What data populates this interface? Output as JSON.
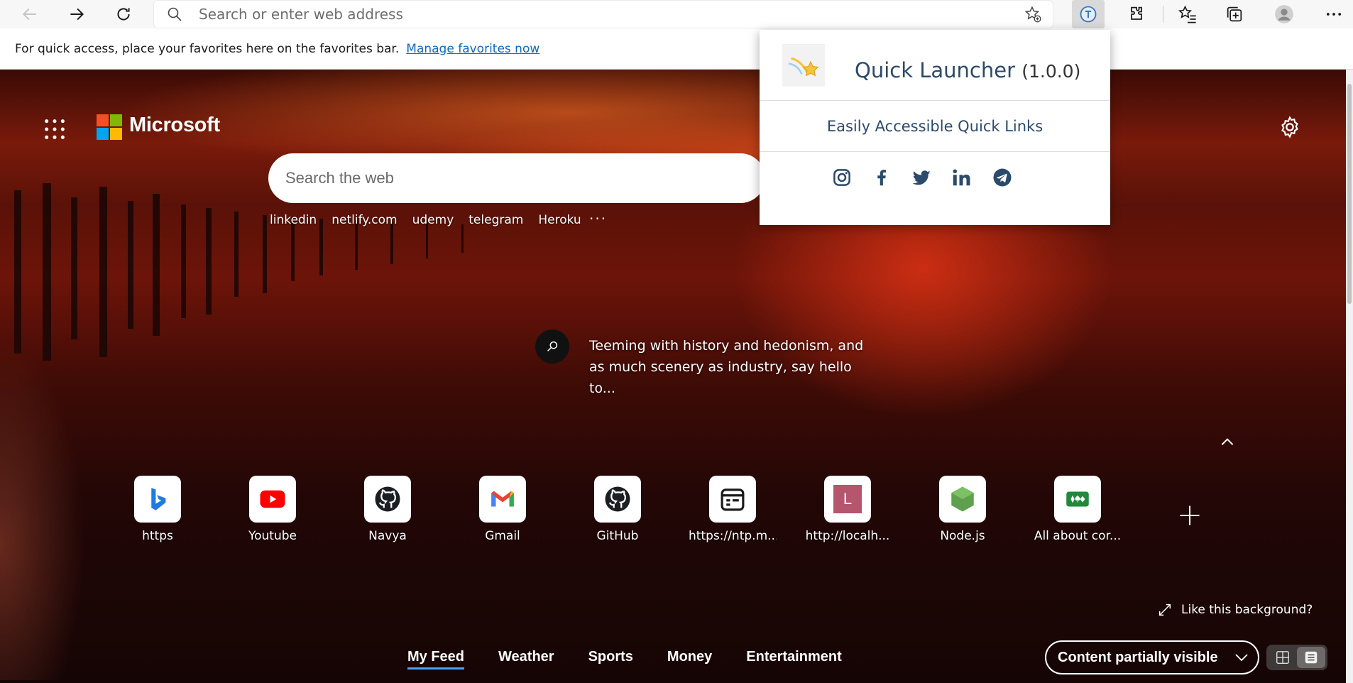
{
  "address_bar": {
    "placeholder": "Search or enter web address"
  },
  "favorites_bar": {
    "message": "For quick access, place your favorites here on the favorites bar.",
    "link_label": "Manage favorites now"
  },
  "ntp": {
    "brand": "Microsoft",
    "search_placeholder": "Search the web",
    "quick_links": [
      "linkedin",
      "netlify.com",
      "udemy",
      "telegram",
      "Heroku"
    ],
    "more_label": "···",
    "story": "Teeming with history and hedonism, and as much scenery as industry, say hello to...",
    "tiles": [
      {
        "label": "https",
        "icon": "bing-icon"
      },
      {
        "label": "Youtube",
        "icon": "youtube-icon"
      },
      {
        "label": "Navya",
        "icon": "github-icon"
      },
      {
        "label": "Gmail",
        "icon": "gmail-icon"
      },
      {
        "label": "GitHub",
        "icon": "github-icon"
      },
      {
        "label": "https://ntp.m...",
        "icon": "calendar-icon"
      },
      {
        "label": "http://localh...",
        "icon": "letter-l-icon",
        "letter": "L"
      },
      {
        "label": "Node.js",
        "icon": "nodejs-icon"
      },
      {
        "label": "All about cor...",
        "icon": "cards-icon"
      }
    ],
    "like_background": "Like this background?",
    "feed_tabs": [
      "My Feed",
      "Weather",
      "Sports",
      "Money",
      "Entertainment"
    ],
    "content_visibility": "Content partially visible"
  },
  "popup": {
    "title": "Quick Launcher",
    "version": "(1.0.0)",
    "subtitle": "Easily Accessible Quick Links",
    "social": [
      "instagram-icon",
      "facebook-icon",
      "twitter-icon",
      "linkedin-icon",
      "telegram-icon"
    ]
  },
  "colors": {
    "accent_link": "#0f6cbd",
    "popup_text": "#2c4a6b",
    "feed_underline": "#4aa3f0"
  }
}
